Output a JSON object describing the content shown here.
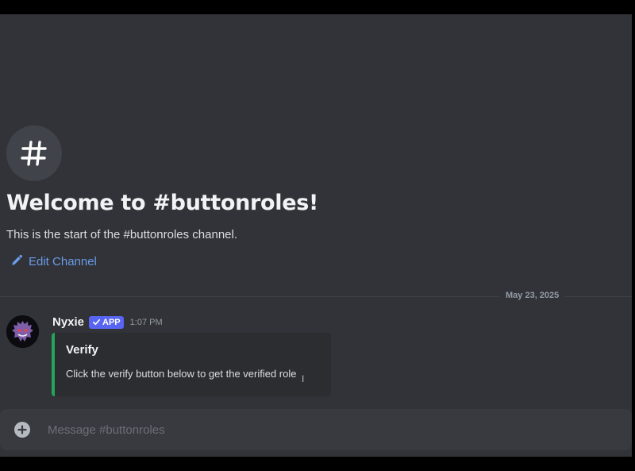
{
  "channel": {
    "icon": "hashtag-icon",
    "welcome_title": "Welcome to #buttonroles!",
    "welcome_subtitle": "This is the start of the #buttonroles channel.",
    "edit_label": "Edit Channel"
  },
  "divider": {
    "date": "May 23, 2025"
  },
  "message": {
    "author": "Nyxie",
    "badge": "APP",
    "time": "1:07 PM",
    "embed": {
      "accent_color": "#23a55a",
      "title": "Verify",
      "description": "Click the verify button below to get the verified role"
    }
  },
  "composer": {
    "placeholder": "Message #buttonroles"
  },
  "colors": {
    "background": "#313338",
    "link": "#6b9ce8",
    "badge": "#5865f2"
  }
}
